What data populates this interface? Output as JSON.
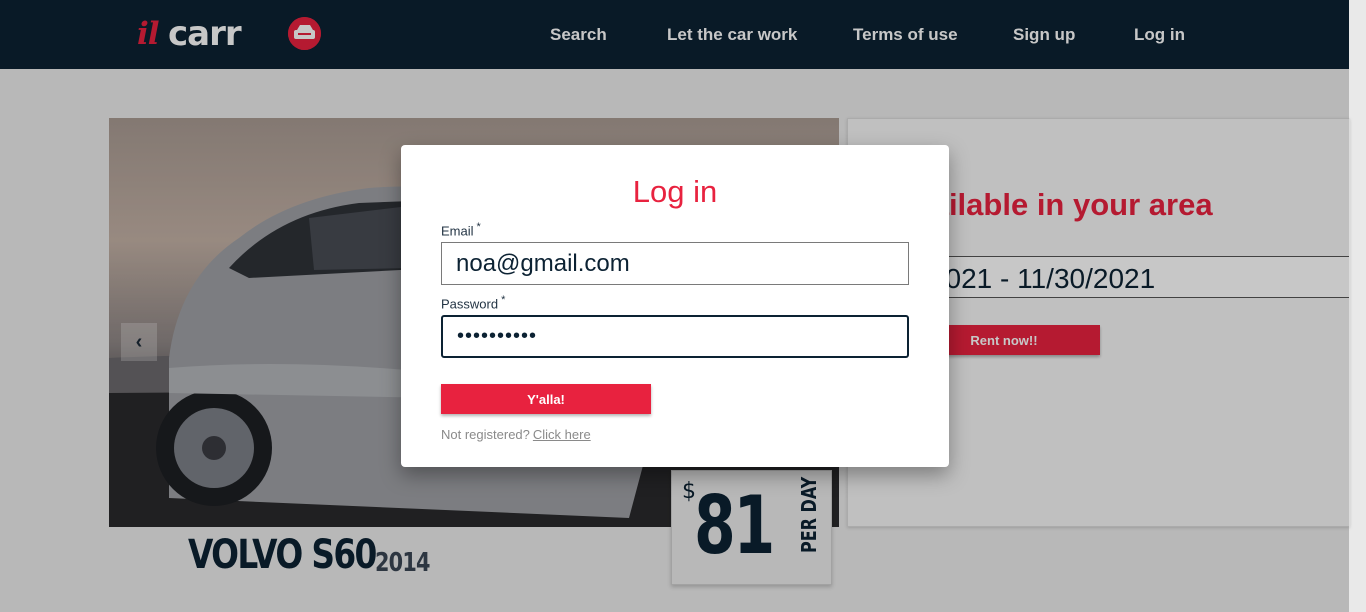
{
  "brand": {
    "logo_il": "il",
    "logo_carr": "carr"
  },
  "nav": {
    "items": [
      {
        "label": "Search"
      },
      {
        "label": "Let the car work"
      },
      {
        "label": "Terms of use"
      },
      {
        "label": "Sign up"
      },
      {
        "label": "Log in"
      }
    ]
  },
  "hero": {
    "prev_icon": "chevron-left-icon",
    "car_name": "VOLVO S60",
    "car_year": "2014",
    "price_currency": "$",
    "price_value": "81",
    "price_unit": "PER DAY"
  },
  "side_panel": {
    "title": ". available in your area",
    "date_range": "27/2021 - 11/30/2021",
    "rent_button": "Rent now!!"
  },
  "login_modal": {
    "title": "Log in",
    "email_label": "Email",
    "required_mark": "*",
    "email_value": "noa@gmail.com",
    "password_label": "Password",
    "password_value": "••••••••••",
    "submit_label": "Y'alla!",
    "register_prompt": "Not registered?",
    "register_link": "Click here"
  },
  "colors": {
    "header_bg": "#0c2233",
    "accent": "#e8223f"
  }
}
